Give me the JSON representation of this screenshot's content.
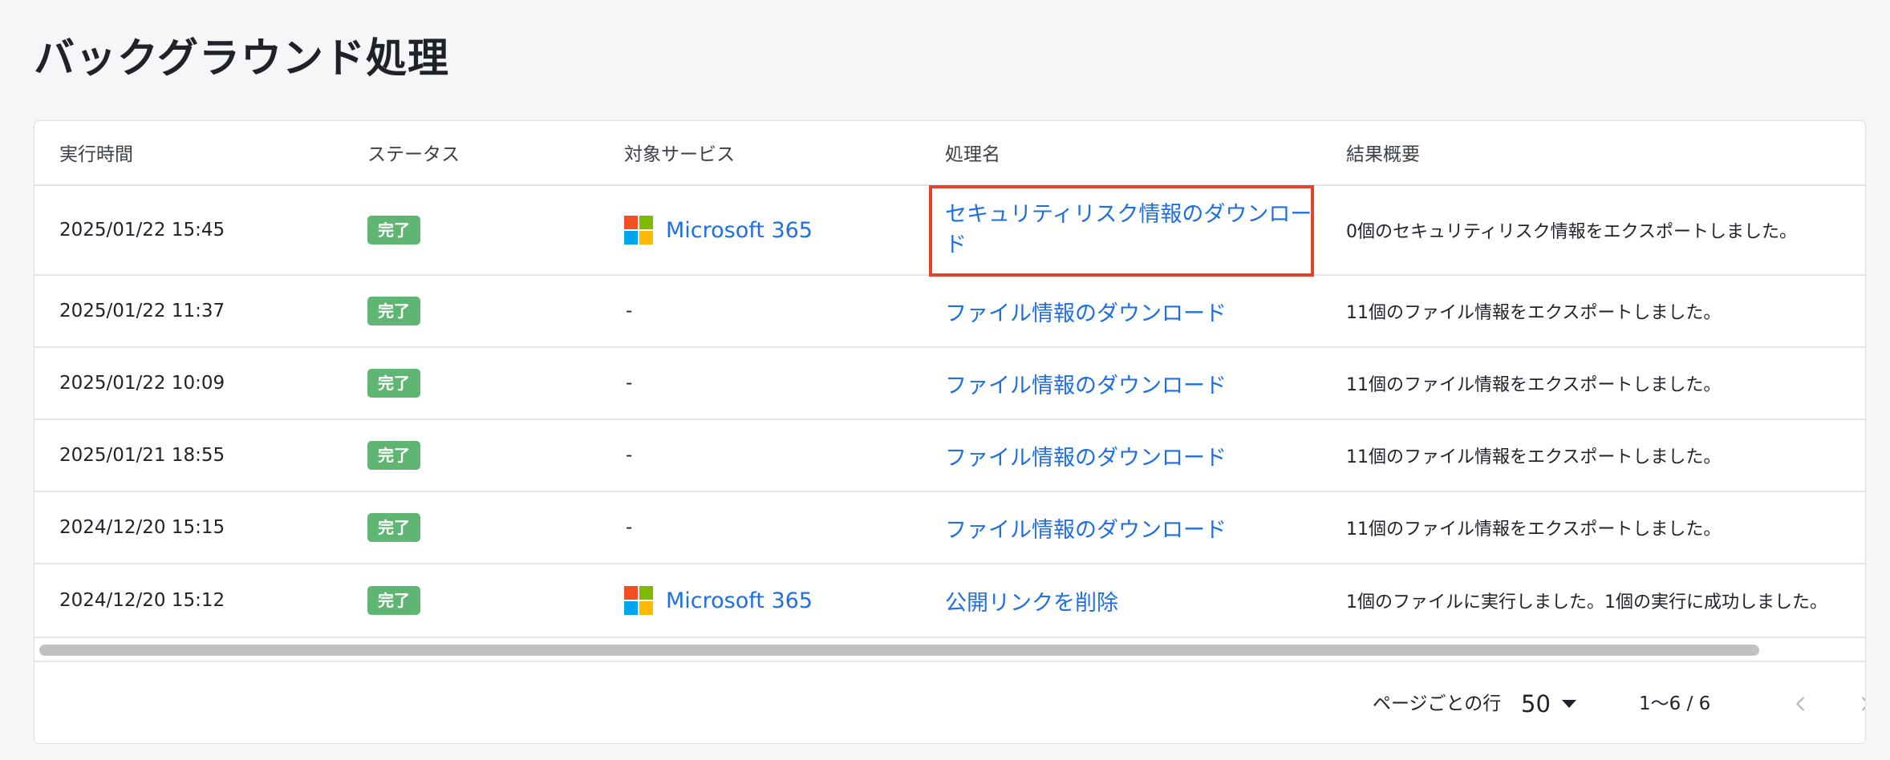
{
  "page": {
    "title": "バックグラウンド処理"
  },
  "table": {
    "headers": {
      "time": "実行時間",
      "status": "ステータス",
      "service": "対象サービス",
      "name": "処理名",
      "result": "結果概要"
    },
    "rows": [
      {
        "time": "2025/01/22 15:45",
        "status": "完了",
        "service": "Microsoft 365",
        "service_icon": "microsoft-logo-icon",
        "name": "セキュリティリスク情報のダウンロード",
        "result": "0個のセキュリティリスク情報をエクスポートしました。"
      },
      {
        "time": "2025/01/22 11:37",
        "status": "完了",
        "service": "-",
        "name": "ファイル情報のダウンロード",
        "result": "11個のファイル情報をエクスポートしました。"
      },
      {
        "time": "2025/01/22 10:09",
        "status": "完了",
        "service": "-",
        "name": "ファイル情報のダウンロード",
        "result": "11個のファイル情報をエクスポートしました。"
      },
      {
        "time": "2025/01/21 18:55",
        "status": "完了",
        "service": "-",
        "name": "ファイル情報のダウンロード",
        "result": "11個のファイル情報をエクスポートしました。"
      },
      {
        "time": "2024/12/20 15:15",
        "status": "完了",
        "service": "-",
        "name": "ファイル情報のダウンロード",
        "result": "11個のファイル情報をエクスポートしました。"
      },
      {
        "time": "2024/12/20 15:12",
        "status": "完了",
        "service": "Microsoft 365",
        "service_icon": "microsoft-logo-icon",
        "name": "公開リンクを削除",
        "result": "1個のファイルに実行しました。1個の実行に成功しました。"
      }
    ]
  },
  "pagination": {
    "rows_per_page_label": "ページごとの行",
    "rows_per_page_value": "50",
    "range_text": "1〜6 / 6",
    "prev_icon": "chevron-left-icon",
    "next_icon": "chevron-right-icon"
  },
  "colors": {
    "status_complete": "#5fb572",
    "link": "#1f6fe0",
    "highlight_border": "#e5412d"
  }
}
